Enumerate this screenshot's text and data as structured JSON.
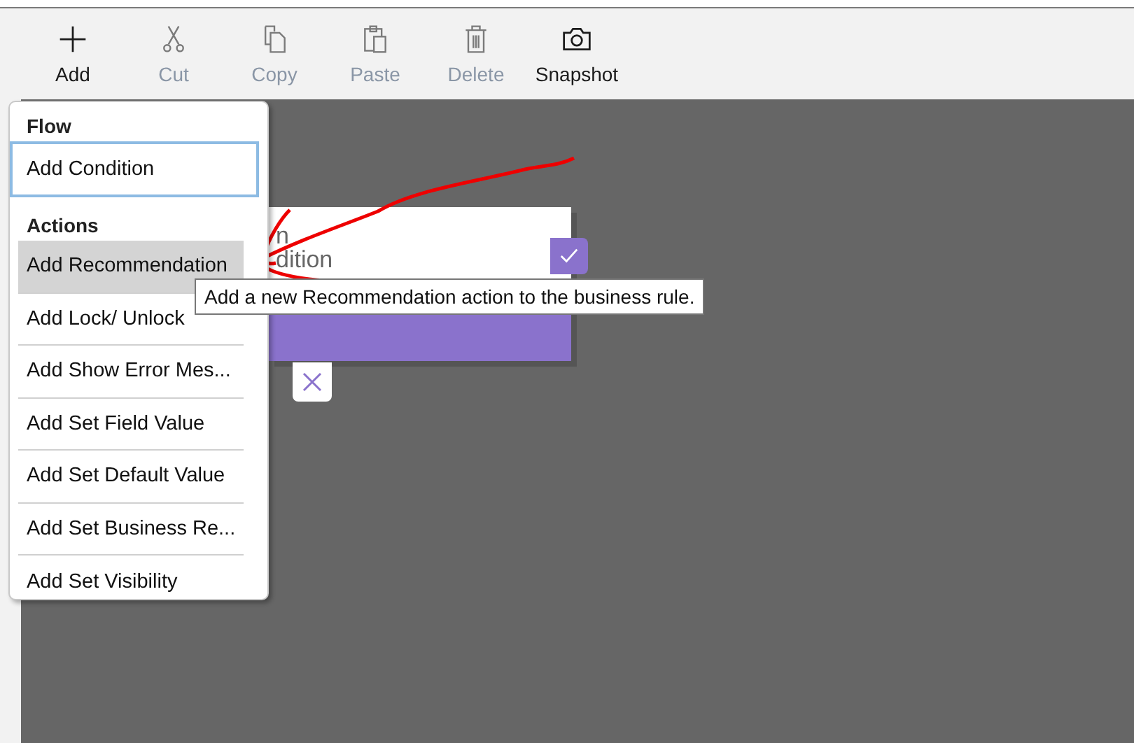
{
  "toolbar": [
    {
      "kind": "add",
      "label": "Add",
      "disabled": false
    },
    {
      "kind": "cut",
      "label": "Cut",
      "disabled": true
    },
    {
      "kind": "copy",
      "label": "Copy",
      "disabled": true
    },
    {
      "kind": "paste",
      "label": "Paste",
      "disabled": true
    },
    {
      "kind": "delete",
      "label": "Delete",
      "disabled": true
    },
    {
      "kind": "snapshot",
      "label": "Snapshot",
      "disabled": false
    }
  ],
  "menu": {
    "sections": [
      {
        "title": "Flow",
        "items": [
          {
            "label": "Add Condition",
            "selected": false,
            "focused": true
          }
        ]
      },
      {
        "title": "Actions",
        "items": [
          {
            "label": "Add Recommendation",
            "selected": true,
            "focused": false
          },
          {
            "label": "Add Lock/ Unlock",
            "selected": false,
            "focused": false
          },
          {
            "label": "Add Show Error Mes...",
            "selected": false,
            "focused": false
          },
          {
            "label": "Add Set Field Value",
            "selected": false,
            "focused": false
          },
          {
            "label": "Add Set Default Value",
            "selected": false,
            "focused": false
          },
          {
            "label": "Add Set Business Re...",
            "selected": false,
            "focused": false
          },
          {
            "label": "Add Set Visibility",
            "selected": false,
            "focused": false
          }
        ]
      }
    ]
  },
  "condition_card": {
    "lines": [
      "n",
      "dition"
    ]
  },
  "tooltip": {
    "text": "Add a new Recommendation action to the business rule."
  }
}
